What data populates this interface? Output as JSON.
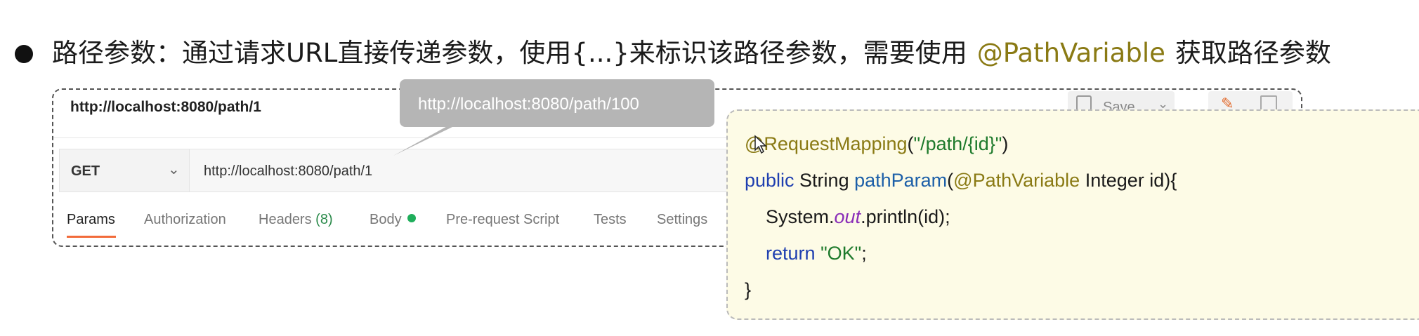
{
  "heading": {
    "part1": "路径参数：通过请求URL直接传递参数，使用{...}来标识该路径参数，需要使用",
    "annotation": "@PathVariable",
    "part2": "获取路径参数"
  },
  "postman": {
    "tab_title": "http://localhost:8080/path/1",
    "save_label": "Save",
    "method": "GET",
    "url": "http://localhost:8080/path/1",
    "tabs": [
      {
        "label": "Params"
      },
      {
        "label": "Authorization"
      },
      {
        "label": "Headers",
        "count": "(8)"
      },
      {
        "label": "Body"
      },
      {
        "label": "Pre-request Script"
      },
      {
        "label": "Tests"
      },
      {
        "label": "Settings"
      }
    ]
  },
  "tooltip": {
    "text": "http://localhost:8080/path/100"
  },
  "code": {
    "line1_annotation": "@RequestMapping",
    "line1_open": "(",
    "line1_string": "\"/path/{id}\"",
    "line1_close": ")",
    "line2_public": "public",
    "line2_type": " String ",
    "line2_method": "pathParam",
    "line2_paren": "(",
    "line2_annotation": "@PathVariable",
    "line2_rest": " Integer id){",
    "line3_system": "System.",
    "line3_out": "out",
    "line3_rest": ".println(id);",
    "line4_return": "return",
    "line4_space": " ",
    "line4_string": "\"OK\"",
    "line4_semicolon": ";",
    "line5": "}"
  },
  "colors": {
    "accent_tab": "#f26b3a",
    "annotation": "#8a7a14",
    "keyword": "#1f3fb0",
    "string": "#1e7a2c"
  }
}
